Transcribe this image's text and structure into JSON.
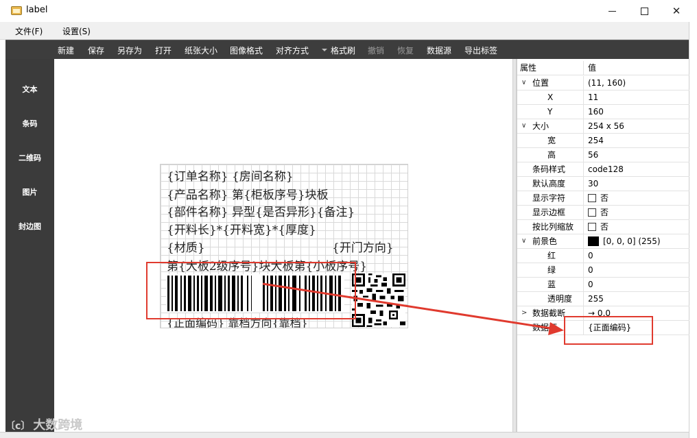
{
  "window": {
    "title": "label"
  },
  "menu": {
    "file": "文件(F)",
    "settings": "设置(S)"
  },
  "toolbar": {
    "new": "新建",
    "save": "保存",
    "save_as": "另存为",
    "open": "打开",
    "paper_size": "纸张大小",
    "image_format": "图像格式",
    "align": "对齐方式",
    "format_brush": "格式刷",
    "undo": "撤销",
    "redo": "恢复",
    "datasource": "数据源",
    "export_label": "导出标签"
  },
  "tools": {
    "text": "文本",
    "barcode": "条码",
    "qrcode": "二维码",
    "image": "图片",
    "edge_image": "封边图"
  },
  "label": {
    "line1": "{订单名称} {房间名称}",
    "line2": "{产品名称} 第{柜板序号}块板",
    "line3": "{部件名称} 异型{是否异形}{备注}",
    "line4": "{开料长}*{开料宽}*{厚度}",
    "line5": "{材质}",
    "line5_right": "{开门方向}",
    "line6": "第{大板2级序号}块大板第{小板序号}",
    "line7": "{正面编码} 靠档方向{靠档}"
  },
  "properties": {
    "header": {
      "name": "属性",
      "value": "值"
    },
    "position": {
      "label": "位置",
      "value": "(11, 160)"
    },
    "x": {
      "label": "X",
      "value": "11"
    },
    "y": {
      "label": "Y",
      "value": "160"
    },
    "size": {
      "label": "大小",
      "value": "254 x 56"
    },
    "width": {
      "label": "宽",
      "value": "254"
    },
    "height": {
      "label": "高",
      "value": "56"
    },
    "barcode_style": {
      "label": "条码样式",
      "value": "code128"
    },
    "default_height": {
      "label": "默认高度",
      "value": "30"
    },
    "show_chars": {
      "label": "显示字符",
      "value": "否"
    },
    "show_border": {
      "label": "显示边框",
      "value": "否"
    },
    "proportional": {
      "label": "按比列缩放",
      "value": "否"
    },
    "foreground": {
      "label": "前景色",
      "value": "[0, 0, 0] (255)",
      "color": "#000000"
    },
    "red": {
      "label": "红",
      "value": "0"
    },
    "green": {
      "label": "绿",
      "value": "0"
    },
    "blue": {
      "label": "蓝",
      "value": "0"
    },
    "alpha": {
      "label": "透明度",
      "value": "255"
    },
    "data_trunc": {
      "label": "数据截断",
      "value": "→ 0,0"
    },
    "datasource": {
      "label": "数据源",
      "value": "{正面编码}"
    }
  },
  "annotation_color": "#e03a2e",
  "watermark": {
    "text": "大数跨境"
  }
}
